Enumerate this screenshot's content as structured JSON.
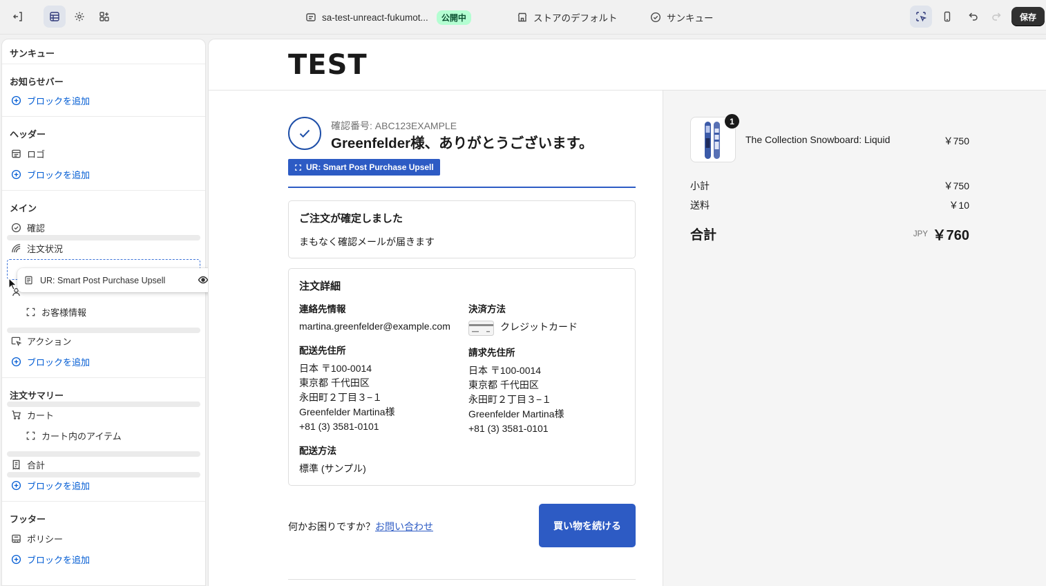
{
  "topbar": {
    "store_name": "sa-test-unreact-fukumot...",
    "status_badge": "公開中",
    "theme": "ストアのデフォルト",
    "page": "サンキュー",
    "save_label": "保存"
  },
  "sidebar": {
    "title": "サンキュー",
    "sections": {
      "announcement": {
        "heading": "お知らせバー",
        "add": "ブロックを追加"
      },
      "header": {
        "heading": "ヘッダー",
        "logo": "ロゴ",
        "add": "ブロックを追加"
      },
      "main": {
        "heading": "メイン",
        "confirmation": "確認",
        "order_status": "注文状況",
        "customer_info": "お客様情報",
        "actions": "アクション",
        "add": "ブロックを追加"
      },
      "summary": {
        "heading": "注文サマリー",
        "cart": "カート",
        "cart_items": "カート内のアイテム",
        "total": "合計",
        "add": "ブロックを追加"
      },
      "footer": {
        "heading": "フッター",
        "policy": "ポリシー",
        "add": "ブロックを追加"
      }
    },
    "drag_item": "UR: Smart Post Purchase Upsell"
  },
  "preview": {
    "logo": "TEST",
    "confirmation_number": "確認番号: ABC123EXAMPLE",
    "thanks": "Greenfelder様、ありがとうございます。",
    "upsell_tag": "UR: Smart Post Purchase Upsell",
    "confirmed_card": {
      "title": "ご注文が確定しました",
      "text": "まもなく確認メールが届きます"
    },
    "details": {
      "title": "注文詳細",
      "contact_label": "連絡先情報",
      "contact_email": "martina.greenfelder@example.com",
      "payment_label": "決済方法",
      "payment_value": "クレジットカード",
      "shipping_addr_label": "配送先住所",
      "shipping_addr": [
        "日本 〒100-0014",
        "東京都 千代田区",
        "永田町２丁目３−１",
        "Greenfelder Martina様",
        "+81 (3) 3581-0101"
      ],
      "billing_addr_label": "請求先住所",
      "billing_addr": [
        "日本 〒100-0014",
        "東京都 千代田区",
        "永田町２丁目３−１",
        "Greenfelder Martina様",
        "+81 (3) 3581-0101"
      ],
      "shipping_method_label": "配送方法",
      "shipping_method": "標準 (サンプル)"
    },
    "help_text": "何かお困りですか？",
    "help_link": "お問い合わせ",
    "continue_button": "買い物を続ける",
    "summary": {
      "qty": "1",
      "product_name": "The Collection Snowboard: Liquid",
      "product_price": "￥750",
      "subtotal_label": "小計",
      "subtotal": "￥750",
      "shipping_label": "送料",
      "shipping": "￥10",
      "total_label": "合計",
      "currency": "JPY",
      "total": "￥760"
    }
  },
  "colors": {
    "accent": "#2d5bc4",
    "link": "#005bd3",
    "badge_bg": "#b4fed2"
  }
}
